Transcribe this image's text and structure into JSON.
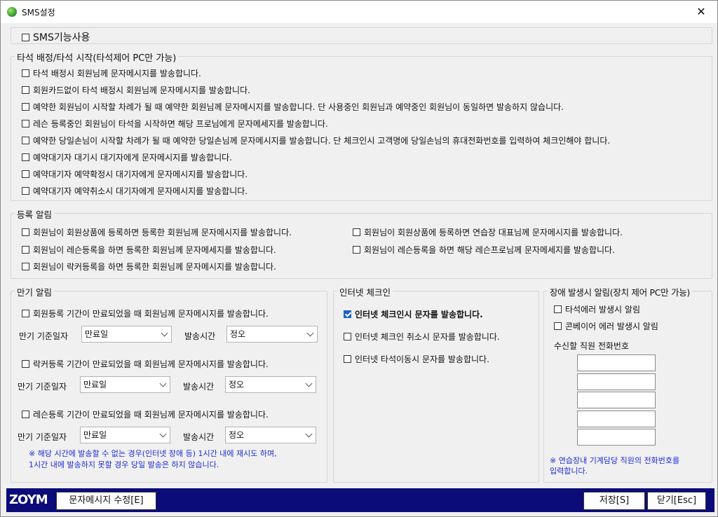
{
  "window": {
    "title": "SMS설정",
    "close_glyph": "✕",
    "icon": "app-globe-icon"
  },
  "sms_enable": {
    "label": "SMS기능사용",
    "checked": false
  },
  "bay": {
    "legend": "타석 배정/타석 시작(타석제어 PC만 가능)",
    "items": [
      {
        "label": "타석 배정시 회원님께 문자메시지를 발송합니다.",
        "checked": false
      },
      {
        "label": "회원카드없이 타석 배정시 회원님께 문자메시지를 발송합니다.",
        "checked": false
      },
      {
        "label": "예약한 회원님이 시작할 차례가 될 때 예약한 회원님께 문자메시지를 발송합니다. 단 사용중인 회원님과 예약중인 회원님이 동일하면 발송하지 않습니다.",
        "checked": false
      },
      {
        "label": "레슨 등록중인 회원님이 타석을 시작하면 해당 프로님에게 문자메세지를 발송합니다.",
        "checked": false
      },
      {
        "label": "예약한 당일손님이 시작할 차례가 될 때 예약한 당일손님께 문자메시지를 발송합니다. 단 체크인시 고객명에 당일손님의 휴대전화번호를 입력하여 체크인해야 합니다.",
        "checked": false
      },
      {
        "label": "예약대기자 대기시 대기자에게 문자메시지를 발송합니다.",
        "checked": false
      },
      {
        "label": "예약대기자 예약확정시 대기자에게 문자메시지를 발송합니다.",
        "checked": false
      },
      {
        "label": "예약대기자 예약취소시 대기자에게 문자메시지를 발송합니다.",
        "checked": false
      }
    ]
  },
  "registration": {
    "legend": "등록 알림",
    "left": [
      {
        "label": "회원님이 회원상품에 등록하면 등록한 회원님께 문자메시지를 발송합니다.",
        "checked": false
      },
      {
        "label": "회원님이 레슨등록을 하면 등록한 회원님께 문자메세지를 발송합니다.",
        "checked": false
      },
      {
        "label": "회원님이 락커등록을 하면 등록한 회원님께 문자메시지를 발송합니다.",
        "checked": false
      }
    ],
    "right": [
      {
        "label": "회원님이 회원상품에 등록하면 연습장 대표님께 문자메시지를 발송합니다.",
        "checked": false
      },
      {
        "label": "회원님이 레슨등록을 하면 해당 레슨프로님께 문자메세지를 발송합니다.",
        "checked": false
      }
    ]
  },
  "expiry": {
    "legend": "만기 알림",
    "date_label": "만기 기준일자",
    "time_label": "발송시간",
    "blocks": [
      {
        "label": "회원등록 기간이 만료되었을 때 회원님께 문자메시지를 발송합니다.",
        "checked": false,
        "date_value": "만료일",
        "time_value": "정오"
      },
      {
        "label": "락커등록 기간이 만료되었을 때 회원님께 문자메시지를 발송합니다.",
        "checked": false,
        "date_value": "만료일",
        "time_value": "정오"
      },
      {
        "label": "레슨등록 기간이 만료되었을 때 회원님께 문자메시지를 발송합니다.",
        "checked": false,
        "date_value": "만료일",
        "time_value": "정오"
      }
    ],
    "note_line1": "※ 해당 시간에 발송할 수 없는 경우(인터넷 장애 등) 1시간 내에 재시도 하며,",
    "note_line2": "1시간 내에 발송하지 못할 경우 당일 발송은 하지 않습니다."
  },
  "checkin": {
    "legend": "인터넷 체크인",
    "items": [
      {
        "label": "인터넷 체크인시 문자를 발송합니다.",
        "checked": true
      },
      {
        "label": "인터넷 체크인 취소시 문자를 발송합니다.",
        "checked": false
      },
      {
        "label": "인터넷 타석이동시 문자를 발송합니다.",
        "checked": false
      }
    ]
  },
  "fault": {
    "legend": "장애 발생시 알림(장치 제어 PC만 가능)",
    "items": [
      {
        "label": "타석에러 발생시 알림",
        "checked": false
      },
      {
        "label": "콘베이어 에러 발생시 알림",
        "checked": false
      }
    ],
    "phone_label": "수신할 직원 전화번호",
    "phones": [
      "",
      "",
      "",
      "",
      ""
    ],
    "note_line1": "※ 연습장내 기계담당 직원의 전화번호를",
    "note_line2": "입력합니다."
  },
  "footer": {
    "logo": "ZOYM",
    "edit_message_label": "문자메시지 수정[E]",
    "save_label": "저장[S]",
    "close_label": "닫기[Esc]"
  },
  "colors": {
    "accent": "#1e62c9",
    "footer_bg": "#0c0b7a",
    "note": "#1f2bd6"
  }
}
